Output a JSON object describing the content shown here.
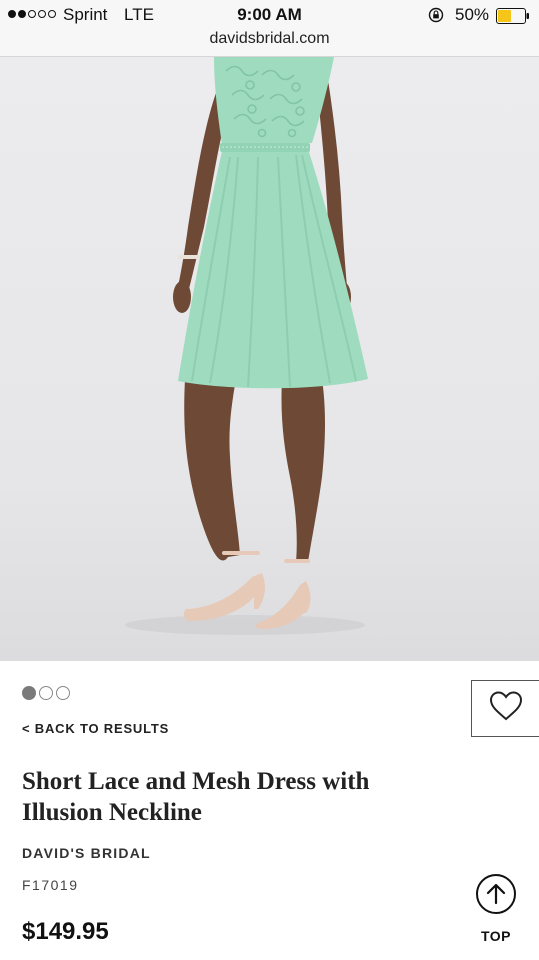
{
  "status_bar": {
    "carrier": "Sprint",
    "network": "LTE",
    "time": "9:00 AM",
    "battery_percent": "50%",
    "battery_level": 0.5,
    "signal_bars_filled": 2,
    "signal_bars_total": 5,
    "url": "davidsbridal.com"
  },
  "product": {
    "image_icon": "product-photo",
    "carousel_total": 3,
    "carousel_active": 1,
    "back_link": "< BACK TO RESULTS",
    "title": "Short Lace and Mesh Dress with Illusion Neckline",
    "brand": "DAVID'S BRIDAL",
    "sku": "F17019",
    "price": "$149.95",
    "favorite_icon": "heart-icon"
  },
  "scroll_top": {
    "label": "TOP",
    "icon": "arrow-up-icon"
  },
  "colors": {
    "dress": "#9fdcbf",
    "battery_fill": "#f5c518",
    "background": "#ffffff"
  }
}
